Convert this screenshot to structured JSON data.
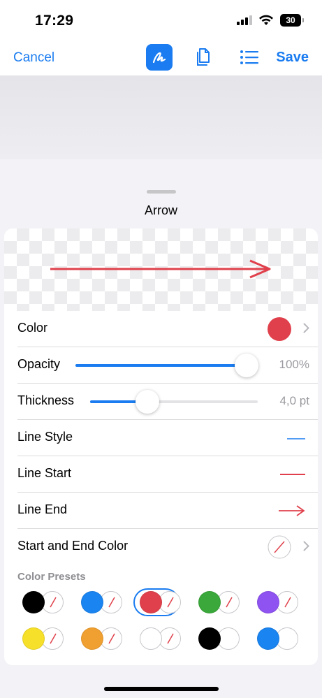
{
  "status_bar": {
    "time": "17:29",
    "battery": "30"
  },
  "toolbar": {
    "cancel_label": "Cancel",
    "save_label": "Save"
  },
  "sheet": {
    "title": "Arrow"
  },
  "properties": {
    "color_label": "Color",
    "color_value": "#e0404b",
    "opacity_label": "Opacity",
    "opacity_value": "100%",
    "opacity_fraction": 1.0,
    "thickness_label": "Thickness",
    "thickness_value": "4,0 pt",
    "thickness_fraction": 0.34,
    "line_style_label": "Line Style",
    "line_start_label": "Line Start",
    "line_end_label": "Line End",
    "start_end_color_label": "Start and End Color"
  },
  "presets": {
    "label": "Color Presets",
    "items": [
      {
        "color": "#000000",
        "slash": true,
        "selected": false
      },
      {
        "color": "#1a84f0",
        "slash": true,
        "selected": false
      },
      {
        "color": "#e0404b",
        "slash": true,
        "selected": true
      },
      {
        "color": "#3aa83a",
        "slash": true,
        "selected": false
      },
      {
        "color": "#8e53f0",
        "slash": true,
        "selected": false
      },
      {
        "color": "#f6e02a",
        "slash": true,
        "selected": false
      },
      {
        "color": "#f0a030",
        "slash": true,
        "selected": false
      },
      {
        "color": "#ffffff",
        "slash": true,
        "selected": false
      },
      {
        "color": "#000000",
        "slash": false,
        "selected": false
      },
      {
        "color": "#1a84f0",
        "slash": false,
        "selected": false
      }
    ]
  },
  "colors": {
    "accent": "#1a7cf0",
    "arrow": "#e0404b"
  }
}
